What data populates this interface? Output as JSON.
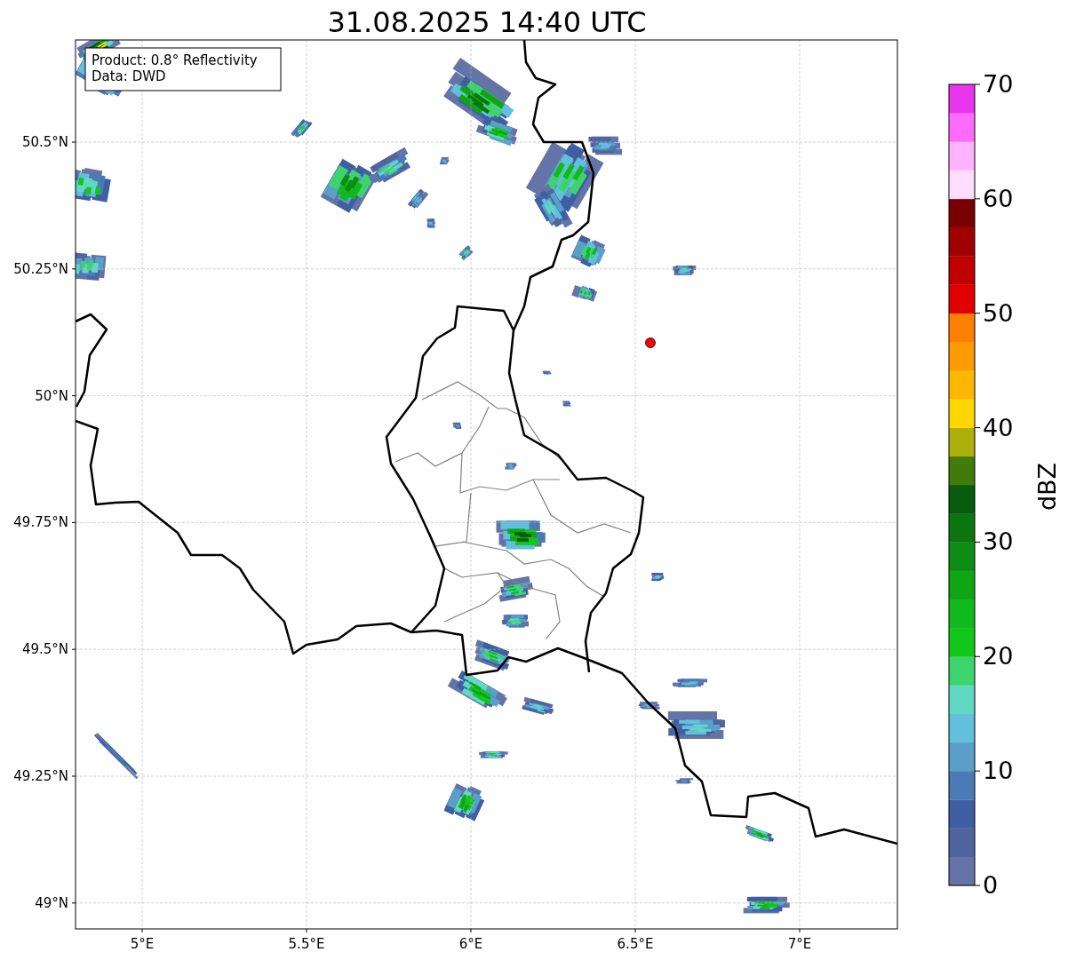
{
  "title": "31.08.2025 14:40 UTC",
  "info_box": [
    "Product: 0.8° Reflectivity",
    "Data: DWD"
  ],
  "y_ticks": [
    "50.5°N",
    "50.25°N",
    "50°N",
    "49.75°N",
    "49.5°N",
    "49.25°N",
    "49°N"
  ],
  "x_ticks": [
    "5°E",
    "5.5°E",
    "6°E",
    "6.5°E",
    "7°E"
  ],
  "colorbar": {
    "label": "dBZ",
    "ticks": [
      "70",
      "60",
      "50",
      "40",
      "30",
      "20",
      "10",
      "0"
    ],
    "bins": [
      {
        "color": "#6474a6"
      },
      {
        "color": "#5065a0"
      },
      {
        "color": "#3f5fa2"
      },
      {
        "color": "#4a7bb5"
      },
      {
        "color": "#5a9fca"
      },
      {
        "color": "#62c0dc"
      },
      {
        "color": "#60d8c4"
      },
      {
        "color": "#3dd46e"
      },
      {
        "color": "#13c71a"
      },
      {
        "color": "#10b91c"
      },
      {
        "color": "#0fa515"
      },
      {
        "color": "#0d8d14"
      },
      {
        "color": "#0b7510"
      },
      {
        "color": "#085c0e"
      },
      {
        "color": "#437a0c"
      },
      {
        "color": "#adb00a"
      },
      {
        "color": "#ffd700"
      },
      {
        "color": "#ffb700"
      },
      {
        "color": "#ff9b00"
      },
      {
        "color": "#ff7f00"
      },
      {
        "color": "#e00000"
      },
      {
        "color": "#c00000"
      },
      {
        "color": "#a00000"
      },
      {
        "color": "#780000"
      },
      {
        "color": "#ffddff"
      },
      {
        "color": "#ffb3ff"
      },
      {
        "color": "#ff6bff"
      },
      {
        "color": "#e935ec"
      }
    ]
  }
}
